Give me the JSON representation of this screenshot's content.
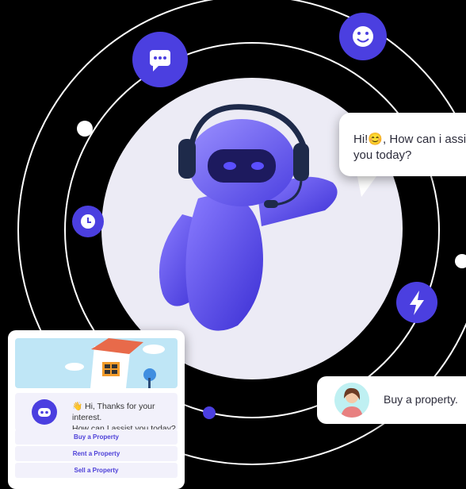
{
  "colors": {
    "background": "#000000",
    "accent": "#4b3fe0",
    "orbit": "#ffffff",
    "center_circle": "#ecebf5"
  },
  "orbit_icons": [
    "chat-dots-icon",
    "smiley-icon",
    "clock-icon",
    "lightning-icon"
  ],
  "bot_bubble": {
    "text_before": "Hi!",
    "emoji": "😊",
    "text_after": ", How can i assist you today?"
  },
  "user_message": {
    "text": "Buy a property."
  },
  "chat_widget": {
    "greeting_emoji": "👋",
    "greeting_line1": " Hi, Thanks for your interest.",
    "greeting_line2": "How can I assist you today?",
    "options": [
      "Buy a Property",
      "Rent a Property",
      "Sell a Property"
    ]
  }
}
